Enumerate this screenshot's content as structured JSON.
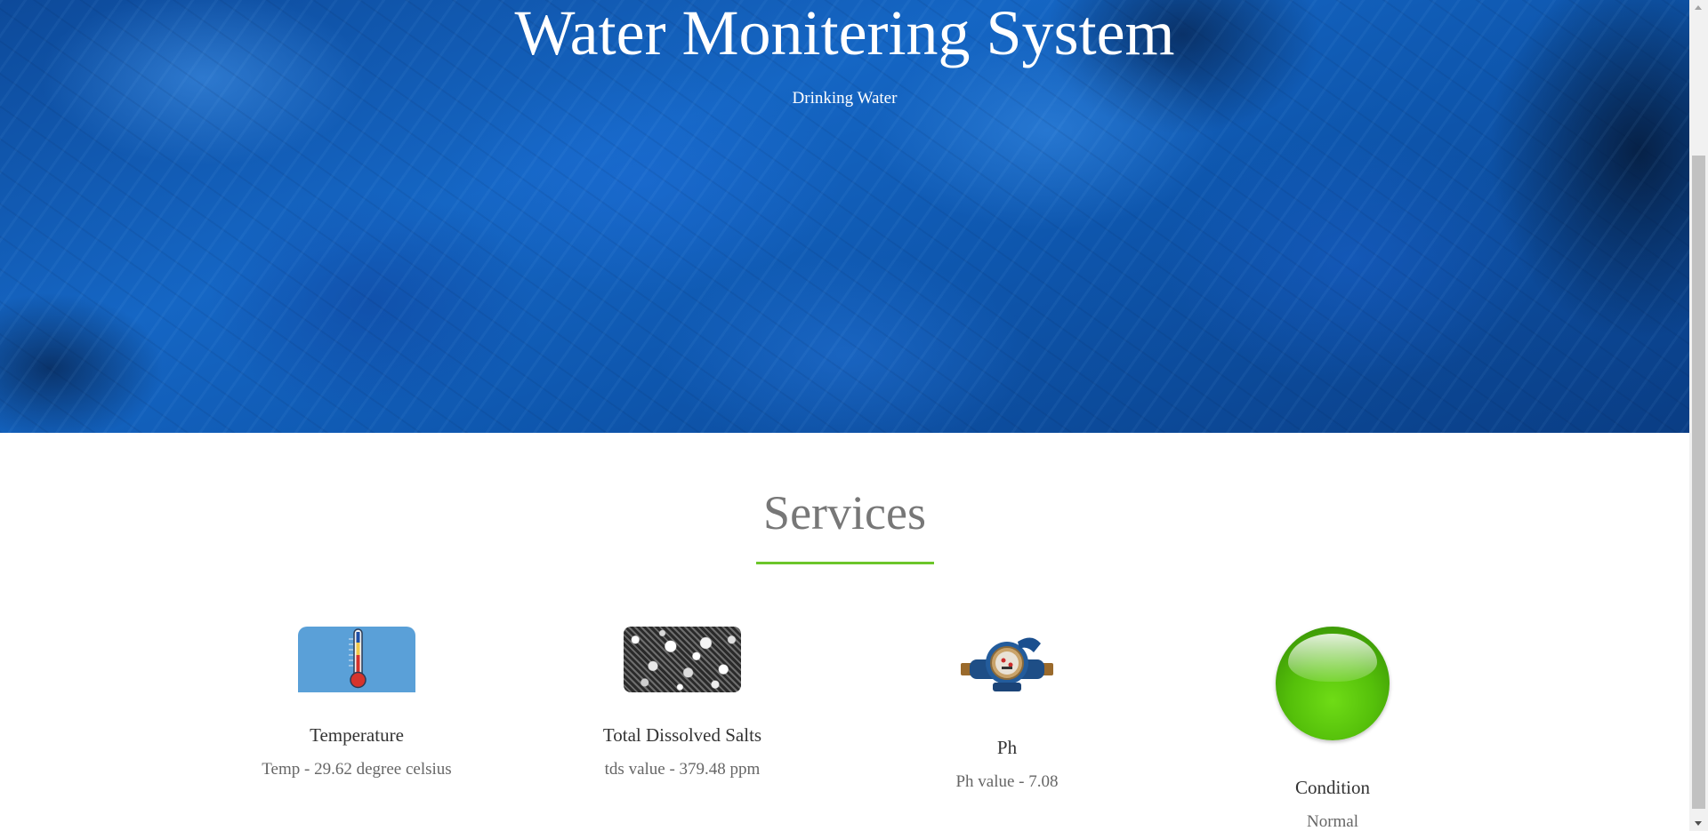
{
  "hero": {
    "title": "Water Monitering System",
    "subtitle": "Drinking Water"
  },
  "services": {
    "title": "Services",
    "accent_color": "#6cc62a",
    "cards": [
      {
        "icon": "thermometer-icon",
        "label": "Temperature",
        "value": "Temp - 29.62 degree celsius"
      },
      {
        "icon": "salt-crystals-icon",
        "label": "Total Dissolved Salts",
        "value": "tds value - 379.48 ppm"
      },
      {
        "icon": "water-meter-icon",
        "label": "Ph",
        "value": "Ph value - 7.08"
      },
      {
        "icon": "green-status-circle-icon",
        "label": "Condition",
        "value": "Normal",
        "status_color": "#55c00a"
      }
    ]
  }
}
